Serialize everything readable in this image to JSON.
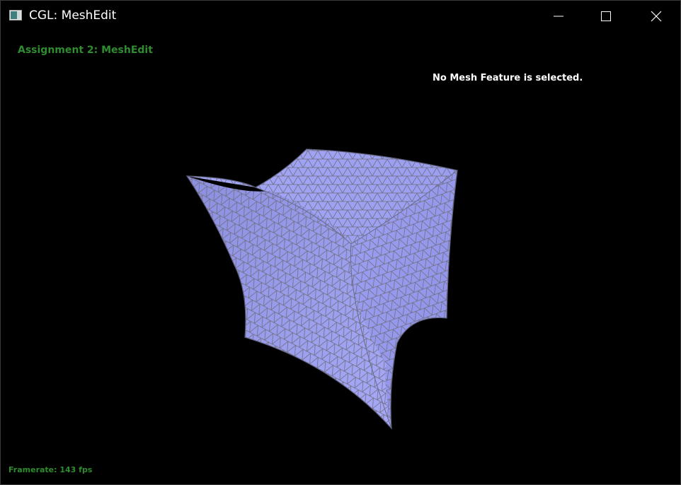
{
  "window": {
    "title": "CGL: MeshEdit",
    "controls": [
      "minimize-icon",
      "maximize-icon",
      "close-icon"
    ]
  },
  "viewport": {
    "assignment_label": "Assignment 2: MeshEdit",
    "selection_status": "No Mesh Feature is selected.",
    "framerate": "Framerate: 143 fps",
    "mesh_color": "#9a9cf2",
    "wire_color": "#7a7a86"
  }
}
